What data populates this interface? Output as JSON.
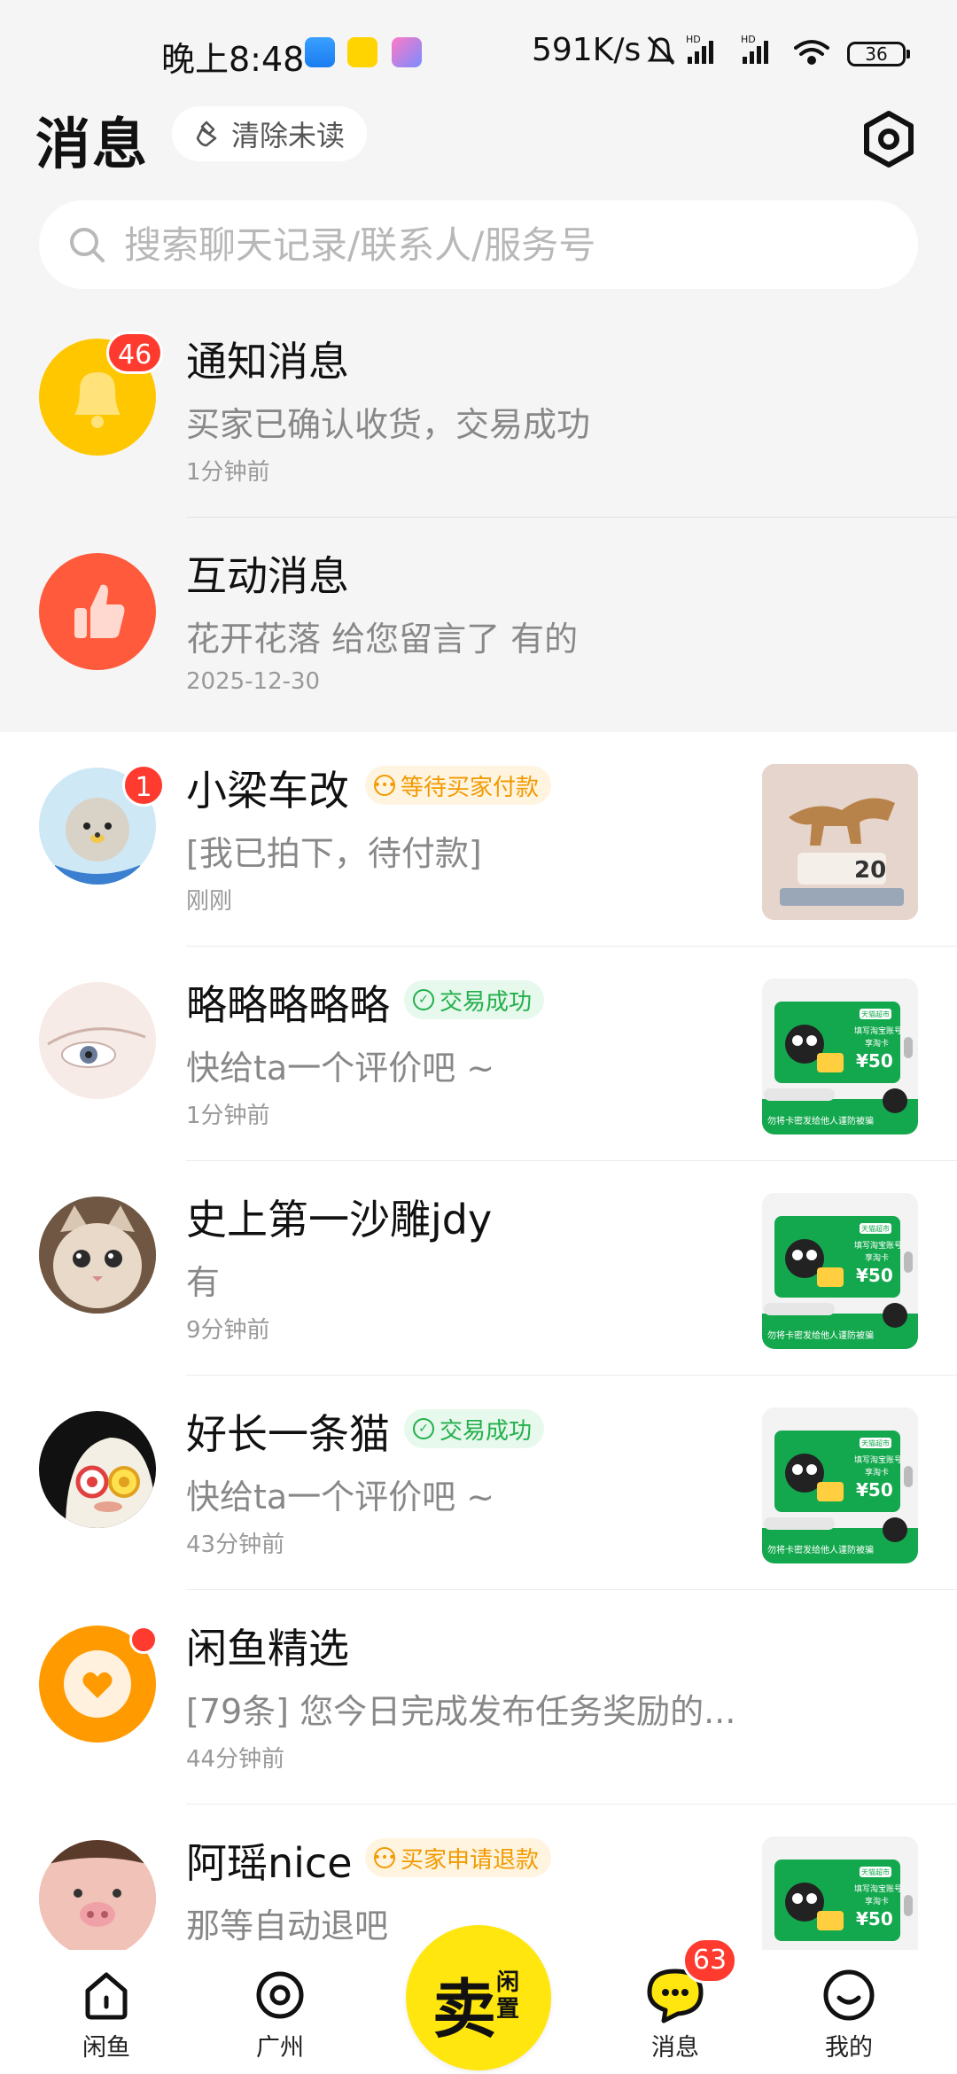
{
  "status_bar": {
    "time": "晚上8:48",
    "net_speed": "591K/s",
    "battery": "36"
  },
  "header": {
    "title": "消息",
    "clear_unread": "清除未读"
  },
  "search": {
    "placeholder": "搜索聊天记录/联系人/服务号"
  },
  "system_rows": [
    {
      "title": "通知消息",
      "preview": "买家已确认收货，交易成功",
      "time": "1分钟前",
      "badge": "46",
      "icon": "bell-icon",
      "color": "#ffc700"
    },
    {
      "title": "互动消息",
      "preview": "花开花落 给您留言了 有的",
      "time": "2025-12-30",
      "icon": "thumbs-up-icon",
      "color": "#ff5a3c"
    }
  ],
  "chats": [
    {
      "name": "小梁车改",
      "tag": "等待买家付款",
      "tag_type": "orange",
      "preview": "[我已拍下，待付款]",
      "time": "刚刚",
      "badge": "1",
      "thumb": "horse-figurine"
    },
    {
      "name": "略略略略略",
      "tag": "交易成功",
      "tag_type": "green",
      "preview": "快给ta一个评价吧 ~",
      "time": "1分钟前",
      "thumb": "taobao-card"
    },
    {
      "name": "史上第一沙雕jdy",
      "preview": "有",
      "time": "9分钟前",
      "thumb": "taobao-card"
    },
    {
      "name": "好长一条猫",
      "tag": "交易成功",
      "tag_type": "green",
      "preview": "快给ta一个评价吧 ~",
      "time": "43分钟前",
      "thumb": "taobao-card"
    },
    {
      "name": "闲鱼精选",
      "preview": "[79条] 您今日完成发布任务奖励的...",
      "time": "44分钟前",
      "dot": true
    },
    {
      "name": "阿瑶nice",
      "tag": "买家申请退款",
      "tag_type": "orange",
      "preview": "那等自动退吧",
      "thumb": "taobao-card"
    }
  ],
  "thumb_card": {
    "badge_text": "天猫超市",
    "line1": "填写淘宝账号",
    "line2": "享淘卡",
    "price": "¥50",
    "footer": "勿将卡密发给他人谨防被骗",
    "horse_number": "20"
  },
  "tab_bar": {
    "tabs": [
      "闲鱼",
      "广州",
      "消息",
      "我的"
    ],
    "sell_big": "卖",
    "sell_small": "闲置",
    "message_badge": "63"
  },
  "colors": {
    "accent_yellow": "#ffe60f",
    "badge_red": "#ff3b30",
    "tag_orange": "#f29a00",
    "tag_green": "#22b04b"
  }
}
